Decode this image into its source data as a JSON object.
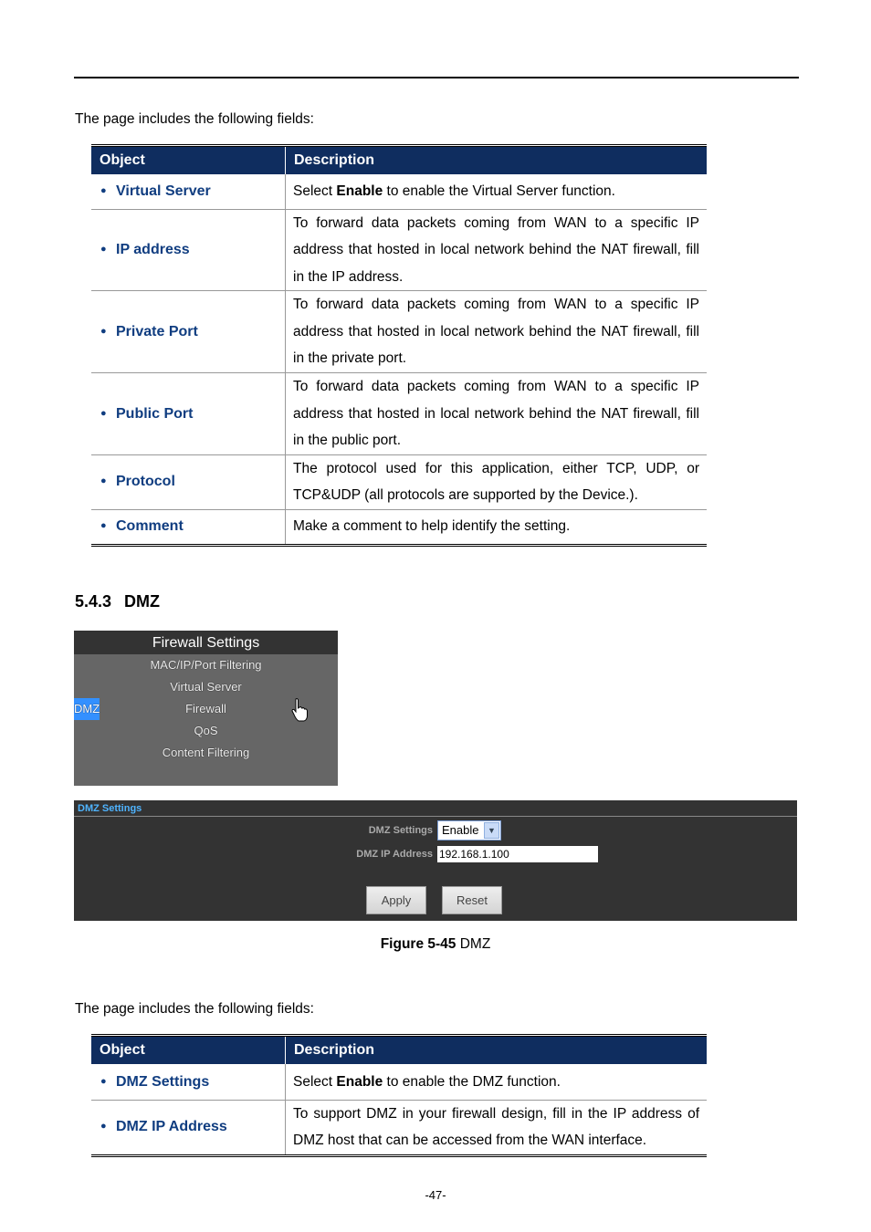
{
  "intro1": "The page includes the following fields:",
  "table1": {
    "headers": [
      "Object",
      "Description"
    ],
    "rows": [
      {
        "object": "Virtual Server",
        "pre": "Select ",
        "bold": "Enable",
        "post": " to enable the Virtual Server function."
      },
      {
        "object": "IP address",
        "desc": "To forward data packets coming from WAN to a specific IP address that hosted in local network behind the NAT firewall, fill in the IP address."
      },
      {
        "object": "Private Port",
        "desc": "To forward data packets coming from WAN to a specific IP address that hosted in local network behind the NAT firewall, fill in the private port."
      },
      {
        "object": "Public Port",
        "desc": "To forward data packets coming from WAN to a specific IP address that hosted in local network behind the NAT firewall, fill in the public port."
      },
      {
        "object": "Protocol",
        "desc": "The protocol used for this application, either TCP, UDP, or TCP&UDP (all protocols are supported by the Device.)."
      },
      {
        "object": "Comment",
        "desc": "Make a comment to help identify the setting."
      }
    ]
  },
  "section": {
    "number": "5.4.3",
    "title": "DMZ"
  },
  "menu": {
    "title": "Firewall Settings",
    "items": [
      "MAC/IP/Port Filtering",
      "Virtual Server",
      "DMZ",
      "Firewall",
      "QoS",
      "Content Filtering"
    ],
    "selected": "DMZ"
  },
  "dmz_panel": {
    "title": "DMZ Settings",
    "settings_label": "DMZ Settings",
    "settings_value": "Enable",
    "ip_label": "DMZ IP Address",
    "ip_value": "192.168.1.100",
    "apply": "Apply",
    "reset": "Reset"
  },
  "caption": {
    "label": "Figure 5-45",
    "text": " DMZ"
  },
  "intro2": "The page includes the following fields:",
  "table2": {
    "headers": [
      "Object",
      "Description"
    ],
    "rows": [
      {
        "object": "DMZ Settings",
        "pre": "Select ",
        "bold": "Enable",
        "post": " to enable the DMZ function."
      },
      {
        "object": "DMZ IP Address",
        "desc": "To support DMZ in your firewall design, fill in the IP address of DMZ host that can be accessed from the WAN interface."
      }
    ]
  },
  "page_number": "-47-",
  "colors": {
    "header_bg": "#0f2d5f",
    "object_text": "#103d80",
    "menu_selected": "#3390ff",
    "panel_title": "#4fb4ff"
  }
}
